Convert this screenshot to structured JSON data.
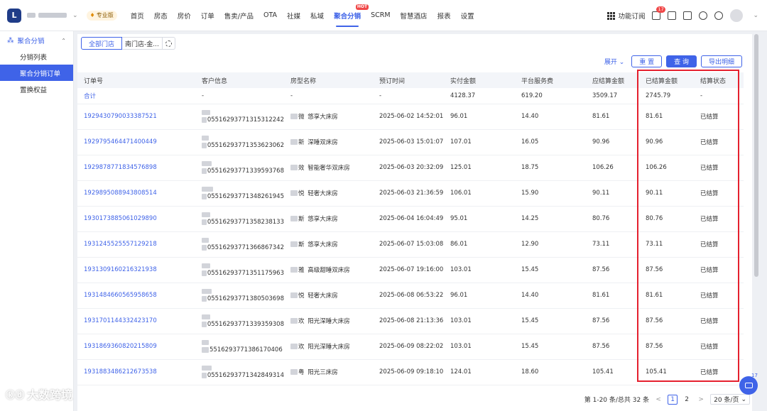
{
  "topbar": {
    "logo_text": "L",
    "pro_badge": "专业版",
    "nav": [
      {
        "label": "首页"
      },
      {
        "label": "房态"
      },
      {
        "label": "房价"
      },
      {
        "label": "订单"
      },
      {
        "label": "售卖/产品"
      },
      {
        "label": "OTA"
      },
      {
        "label": "社媒"
      },
      {
        "label": "私域"
      },
      {
        "label": "聚合分销",
        "active": true,
        "hot": "HOT"
      },
      {
        "label": "SCRM"
      },
      {
        "label": "智慧酒店"
      },
      {
        "label": "报表"
      },
      {
        "label": "设置"
      }
    ],
    "func_subscribe": "功能订阅",
    "msg_count": "17"
  },
  "sidebar": {
    "group_label": "聚合分销",
    "items": [
      {
        "label": "分销列表"
      },
      {
        "label": "聚合分销订单",
        "active": true
      },
      {
        "label": "置换权益"
      }
    ]
  },
  "filters": {
    "store_all": "全部门店",
    "store_second": "南门店-金..."
  },
  "actions": {
    "expand": "展开",
    "reset": "重 置",
    "query": "查 询",
    "export": "导出明细"
  },
  "table": {
    "headers": [
      "订单号",
      "客户信息",
      "房型名称",
      "预订时间",
      "实付金额",
      "平台服务费",
      "应结算金额",
      "已结算金额",
      "结算状态"
    ],
    "summary": {
      "label": "合计",
      "cust": "-",
      "room": "-",
      "time": "-",
      "paid": "4128.37",
      "fee": "619.20",
      "due": "3509.17",
      "settled": "2745.79",
      "status": "-"
    },
    "rows": [
      {
        "order": "1929430790033387521",
        "phone": "05516293771315312242",
        "room_prefix": "微",
        "room": "悠享大床房",
        "time": "2025-06-02 14:52:01",
        "paid": "96.01",
        "fee": "14.40",
        "due": "81.61",
        "settled": "81.61",
        "status": "已结算"
      },
      {
        "order": "1929795464471400449",
        "phone": "05516293771353623062",
        "room_prefix": "新",
        "room": "深睡双床房",
        "time": "2025-06-03 15:01:07",
        "paid": "107.01",
        "fee": "16.05",
        "due": "90.96",
        "settled": "90.96",
        "status": "已结算"
      },
      {
        "order": "1929878771834576898",
        "phone": "05516293771339593768",
        "room_prefix": "效",
        "room": "智能奢华双床房",
        "time": "2025-06-03 20:32:09",
        "paid": "125.01",
        "fee": "18.75",
        "due": "106.26",
        "settled": "106.26",
        "status": "已结算"
      },
      {
        "order": "1929895088943808514",
        "phone": "05516293771348261945",
        "room_prefix": "悦",
        "room": "轻奢大床房",
        "time": "2025-06-03 21:36:59",
        "paid": "106.01",
        "fee": "15.90",
        "due": "90.11",
        "settled": "90.11",
        "status": "已结算"
      },
      {
        "order": "1930173885061029890",
        "phone": "05516293771358238133",
        "room_prefix": "斯",
        "room": "悠享大床房",
        "time": "2025-06-04 16:04:49",
        "paid": "95.01",
        "fee": "14.25",
        "due": "80.76",
        "settled": "80.76",
        "status": "已结算"
      },
      {
        "order": "1931245525557129218",
        "phone": "05516293771366867342",
        "room_prefix": "斯",
        "room": "悠享大床房",
        "time": "2025-06-07 15:03:08",
        "paid": "86.01",
        "fee": "12.90",
        "due": "73.11",
        "settled": "73.11",
        "status": "已结算"
      },
      {
        "order": "1931309160216321938",
        "phone": "05516293771351175963",
        "room_prefix": "雅",
        "room": "高级甜睡双床房",
        "time": "2025-06-07 19:16:00",
        "paid": "103.01",
        "fee": "15.45",
        "due": "87.56",
        "settled": "87.56",
        "status": "已结算"
      },
      {
        "order": "1931484660565958658",
        "phone": "05516293771380503698",
        "room_prefix": "悦",
        "room": "轻奢大床房",
        "time": "2025-06-08 06:53:22",
        "paid": "96.01",
        "fee": "14.40",
        "due": "81.61",
        "settled": "81.61",
        "status": "已结算"
      },
      {
        "order": "1931701144332423170",
        "phone": "05516293771339359308",
        "room_prefix": "欢",
        "room": "阳光深睡大床房",
        "time": "2025-06-08 21:13:36",
        "paid": "103.01",
        "fee": "15.45",
        "due": "87.56",
        "settled": "87.56",
        "status": "已结算"
      },
      {
        "order": "1931869360820215809",
        "phone": "5516293771386170406",
        "room_prefix": "欢",
        "room": "阳光深睡大床房",
        "time": "2025-06-09 08:22:02",
        "paid": "103.01",
        "fee": "15.45",
        "due": "87.56",
        "settled": "87.56",
        "status": "已结算"
      },
      {
        "order": "1931883486212673538",
        "phone": "05516293771342849314",
        "room_prefix": "粤",
        "room": "阳光三床房",
        "time": "2025-06-09 09:18:10",
        "paid": "124.01",
        "fee": "18.60",
        "due": "105.41",
        "settled": "105.41",
        "status": "已结算"
      }
    ]
  },
  "pagination": {
    "summary": "第 1-20 条/总共 32 条",
    "prev": "<",
    "pages": [
      "1",
      "2"
    ],
    "next": ">",
    "size": "20 条/页"
  },
  "chat": {
    "count": "17"
  },
  "watermark": "大数跨境",
  "colors": {
    "accent": "#3f63e8",
    "highlight": "#e5202e",
    "hot": "#f04848"
  }
}
